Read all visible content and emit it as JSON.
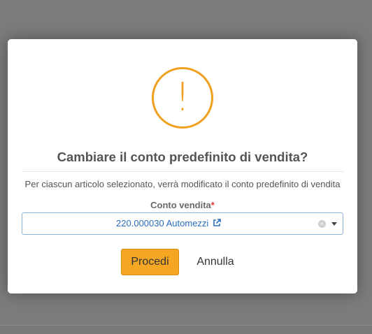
{
  "dialog": {
    "icon": "warning-exclamation-icon",
    "icon_glyph": "!",
    "title": "Cambiare il conto predefinito di vendita?",
    "description": "Per ciascun articolo selezionato, verrà modificato il conto predefinito di vendita",
    "field": {
      "label": "Conto vendita",
      "required_mark": "*",
      "selected_value": "220.000030 Automezzi",
      "external_link_icon": "external-link-icon",
      "clear_icon": "clear-icon",
      "clear_glyph": "×",
      "dropdown_icon": "caret-down-icon"
    },
    "buttons": {
      "proceed": "Procedi",
      "cancel": "Annulla"
    }
  },
  "colors": {
    "accent": "#f5a623",
    "warning": "#f0a020",
    "link": "#2a6fbf",
    "required": "#dd3333",
    "overlay": "#7b7b7b"
  }
}
